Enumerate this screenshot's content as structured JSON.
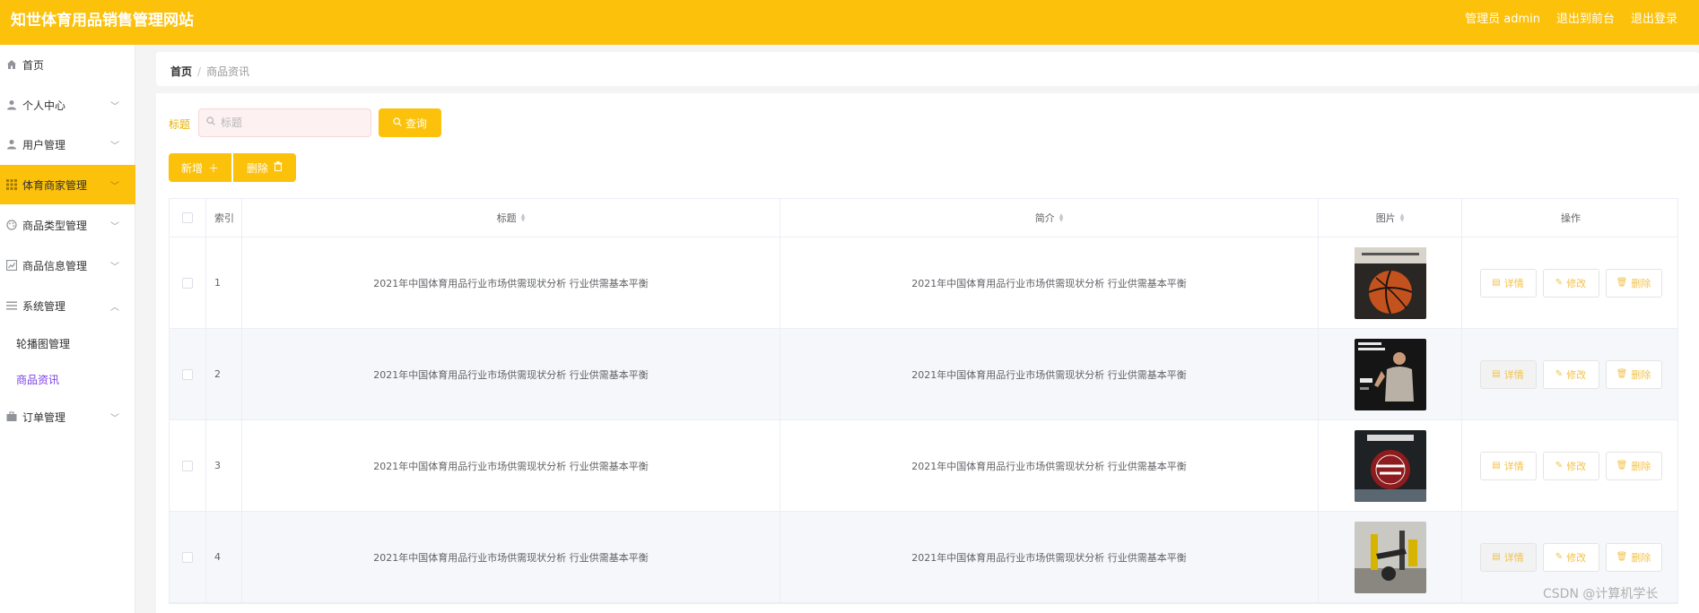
{
  "header": {
    "title": "知世体育用品销售管理网站",
    "admin": "管理员 admin",
    "back_front": "退出到前台",
    "logout": "退出登录"
  },
  "sidebar": {
    "items": [
      {
        "label": "首页",
        "icon": "home-icon"
      },
      {
        "label": "个人中心",
        "icon": "user-icon"
      },
      {
        "label": "用户管理",
        "icon": "user-icon"
      },
      {
        "label": "体育商家管理",
        "icon": "grid-icon"
      },
      {
        "label": "商品类型管理",
        "icon": "palette-icon"
      },
      {
        "label": "商品信息管理",
        "icon": "chart-icon"
      },
      {
        "label": "系统管理",
        "icon": "list-icon"
      },
      {
        "label": "订单管理",
        "icon": "briefcase-icon"
      }
    ],
    "sub_items": [
      {
        "label": "轮播图管理"
      },
      {
        "label": "商品资讯"
      }
    ]
  },
  "breadcrumb": {
    "home": "首页",
    "separator": "/",
    "current": "商品资讯"
  },
  "search": {
    "label": "标题",
    "placeholder": "标题",
    "value": "",
    "query_label": "查询"
  },
  "toolbar": {
    "add_label": "新增",
    "add_icon": "plus-icon",
    "delete_label": "删除",
    "delete_icon": "trash-icon"
  },
  "table": {
    "headers": {
      "index": "索引",
      "title": "标题",
      "intro": "简介",
      "image": "图片",
      "operation": "操作"
    },
    "rows": [
      {
        "index": "1",
        "title": "2021年中国体育用品行业市场供需现状分析 行业供需基本平衡",
        "intro": "2021年中国体育用品行业市场供需现状分析 行业供需基本平衡"
      },
      {
        "index": "2",
        "title": "2021年中国体育用品行业市场供需现状分析 行业供需基本平衡",
        "intro": "2021年中国体育用品行业市场供需现状分析 行业供需基本平衡"
      },
      {
        "index": "3",
        "title": "2021年中国体育用品行业市场供需现状分析 行业供需基本平衡",
        "intro": "2021年中国体育用品行业市场供需现状分析 行业供需基本平衡"
      },
      {
        "index": "4",
        "title": "2021年中国体育用品行业市场供需现状分析 行业供需基本平衡",
        "intro": "2021年中国体育用品行业市场供需现状分析 行业供需基本平衡"
      }
    ],
    "actions": {
      "detail": "详情",
      "edit": "修改",
      "delete": "删除"
    }
  },
  "watermark": "CSDN @计算机学长",
  "colors": {
    "accent": "#fcc10a",
    "active_submenu": "#7b3fe4",
    "action_text": "#f3c24a"
  }
}
